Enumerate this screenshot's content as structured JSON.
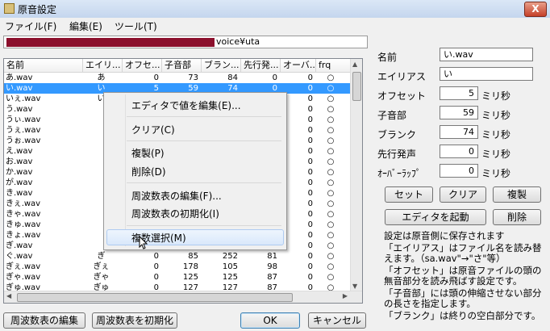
{
  "window": {
    "title": "原音設定",
    "close_label": "X"
  },
  "menu": [
    "ファイル(F)",
    "編集(E)",
    "ツール(T)"
  ],
  "path": {
    "visible_text": "voice¥uta"
  },
  "table": {
    "headers": [
      "名前",
      "エイリ...",
      "オフセ...",
      "子音部",
      "ブラン...",
      "先行発...",
      "オーバ...",
      "frq"
    ],
    "rows": [
      {
        "name": "あ.wav",
        "alias": "あ",
        "offset": "0",
        "consonant": "73",
        "blank": "84",
        "preutter": "0",
        "overlap": "0",
        "frq": "○",
        "selected": false
      },
      {
        "name": "い.wav",
        "alias": "い",
        "offset": "5",
        "consonant": "59",
        "blank": "74",
        "preutter": "0",
        "overlap": "0",
        "frq": "○",
        "selected": true
      },
      {
        "name": "いぇ.wav",
        "alias": "い",
        "offset": "",
        "consonant": "",
        "blank": "",
        "preutter": "",
        "overlap": "0",
        "frq": "○",
        "selected": false
      },
      {
        "name": "う.wav",
        "alias": "",
        "offset": "",
        "consonant": "",
        "blank": "",
        "preutter": "",
        "overlap": "0",
        "frq": "○",
        "selected": false
      },
      {
        "name": "うぃ.wav",
        "alias": "",
        "offset": "",
        "consonant": "",
        "blank": "",
        "preutter": "",
        "overlap": "0",
        "frq": "○",
        "selected": false
      },
      {
        "name": "うぇ.wav",
        "alias": "",
        "offset": "",
        "consonant": "",
        "blank": "",
        "preutter": "",
        "overlap": "0",
        "frq": "○",
        "selected": false
      },
      {
        "name": "うぉ.wav",
        "alias": "",
        "offset": "",
        "consonant": "",
        "blank": "",
        "preutter": "",
        "overlap": "0",
        "frq": "○",
        "selected": false
      },
      {
        "name": "え.wav",
        "alias": "",
        "offset": "",
        "consonant": "",
        "blank": "",
        "preutter": "",
        "overlap": "0",
        "frq": "○",
        "selected": false
      },
      {
        "name": "お.wav",
        "alias": "",
        "offset": "",
        "consonant": "",
        "blank": "",
        "preutter": "",
        "overlap": "0",
        "frq": "○",
        "selected": false
      },
      {
        "name": "か.wav",
        "alias": "",
        "offset": "",
        "consonant": "",
        "blank": "",
        "preutter": "",
        "overlap": "0",
        "frq": "○",
        "selected": false
      },
      {
        "name": "が.wav",
        "alias": "",
        "offset": "",
        "consonant": "",
        "blank": "",
        "preutter": "",
        "overlap": "0",
        "frq": "○",
        "selected": false
      },
      {
        "name": "き.wav",
        "alias": "",
        "offset": "",
        "consonant": "",
        "blank": "",
        "preutter": "",
        "overlap": "0",
        "frq": "○",
        "selected": false
      },
      {
        "name": "きぇ.wav",
        "alias": "",
        "offset": "",
        "consonant": "",
        "blank": "",
        "preutter": "",
        "overlap": "0",
        "frq": "○",
        "selected": false
      },
      {
        "name": "きゃ.wav",
        "alias": "",
        "offset": "",
        "consonant": "",
        "blank": "",
        "preutter": "",
        "overlap": "0",
        "frq": "○",
        "selected": false
      },
      {
        "name": "きゅ.wav",
        "alias": "",
        "offset": "",
        "consonant": "",
        "blank": "",
        "preutter": "",
        "overlap": "0",
        "frq": "○",
        "selected": false
      },
      {
        "name": "きょ.wav",
        "alias": "",
        "offset": "",
        "consonant": "",
        "blank": "",
        "preutter": "",
        "overlap": "0",
        "frq": "○",
        "selected": false
      },
      {
        "name": "ぎ.wav",
        "alias": "",
        "offset": "",
        "consonant": "",
        "blank": "",
        "preutter": "",
        "overlap": "0",
        "frq": "○",
        "selected": false
      },
      {
        "name": "ぐ.wav",
        "alias": "ぎ",
        "offset": "0",
        "consonant": "85",
        "blank": "252",
        "preutter": "81",
        "overlap": "0",
        "frq": "○",
        "selected": false
      },
      {
        "name": "ぎぇ.wav",
        "alias": "ぎぇ",
        "offset": "0",
        "consonant": "178",
        "blank": "105",
        "preutter": "98",
        "overlap": "0",
        "frq": "○",
        "selected": false
      },
      {
        "name": "ぎゃ.wav",
        "alias": "ぎゃ",
        "offset": "0",
        "consonant": "125",
        "blank": "125",
        "preutter": "87",
        "overlap": "0",
        "frq": "○",
        "selected": false
      },
      {
        "name": "ぎゅ.wav",
        "alias": "ぎゅ",
        "offset": "0",
        "consonant": "127",
        "blank": "127",
        "preutter": "87",
        "overlap": "0",
        "frq": "○",
        "selected": false
      }
    ]
  },
  "context_menu": {
    "items": [
      "エディタで値を編集(E)...",
      "クリア(C)",
      "複製(P)",
      "削除(D)",
      "周波数表の編集(F)...",
      "周波数表の初期化(I)",
      "複数選択(M)"
    ]
  },
  "fields": {
    "name": {
      "label": "名前",
      "value": "い.wav"
    },
    "alias": {
      "label": "エイリアス",
      "value": "い"
    },
    "offset": {
      "label": "オフセット",
      "value": "5",
      "unit": "ミリ秒"
    },
    "consonant": {
      "label": "子音部",
      "value": "59",
      "unit": "ミリ秒"
    },
    "blank": {
      "label": "ブランク",
      "value": "74",
      "unit": "ミリ秒"
    },
    "preutter": {
      "label": "先行発声",
      "value": "0",
      "unit": "ミリ秒"
    },
    "overlap": {
      "label": "ｵｰﾊﾞｰﾗｯﾌﾟ",
      "value": "0",
      "unit": "ミリ秒"
    }
  },
  "buttons": {
    "set": "セット",
    "clear": "クリア",
    "duplicate": "複製",
    "launch_editor": "エディタを起動",
    "delete": "削除",
    "edit_freq": "周波数表の編集",
    "init_freq": "周波数表を初期化",
    "ok": "OK",
    "cancel": "キャンセル"
  },
  "help": {
    "line1": "設定は原音側に保存されます",
    "line2": "「エイリアス」はファイル名を読み替えます。（sa.wav\"→\"さ\"等）",
    "line3": "「オフセット」は原音ファイルの頭の無音部分を読み飛ばす設定です。",
    "line4": "「子音部」には頭の伸縮させない部分の長さを指定します。",
    "line5": "「ブランク」は終りの空白部分です。"
  }
}
